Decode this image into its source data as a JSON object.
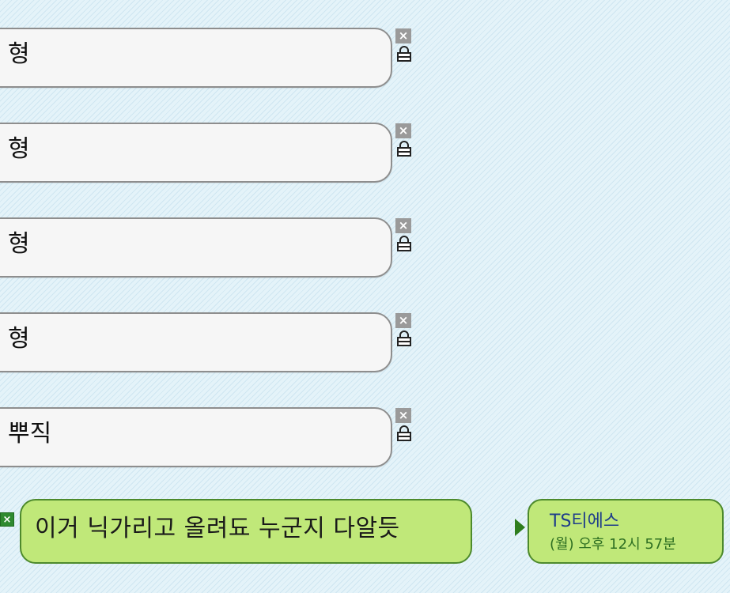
{
  "messages": [
    {
      "text": "형"
    },
    {
      "text": "형"
    },
    {
      "text": "형"
    },
    {
      "text": "형"
    },
    {
      "text": "뿌직"
    }
  ],
  "icons": {
    "close": "close-icon",
    "lock": "lock-icon",
    "play": "play-icon"
  },
  "close_glyph": "×",
  "highlight_message": {
    "text": "이거 닉가리고 올려됴 누군지 다알듯"
  },
  "info": {
    "sender": "TS티에스",
    "timestamp": "(월) 오후 12시 57분"
  },
  "colors": {
    "background": "#dbeef6",
    "bubble_fill": "#f6f6f6",
    "bubble_border": "#8e8e8e",
    "green_fill": "#c0e879",
    "green_border": "#4d8a2c",
    "sender_color": "#1e3d8a",
    "timestamp_color": "#2e6f22"
  }
}
